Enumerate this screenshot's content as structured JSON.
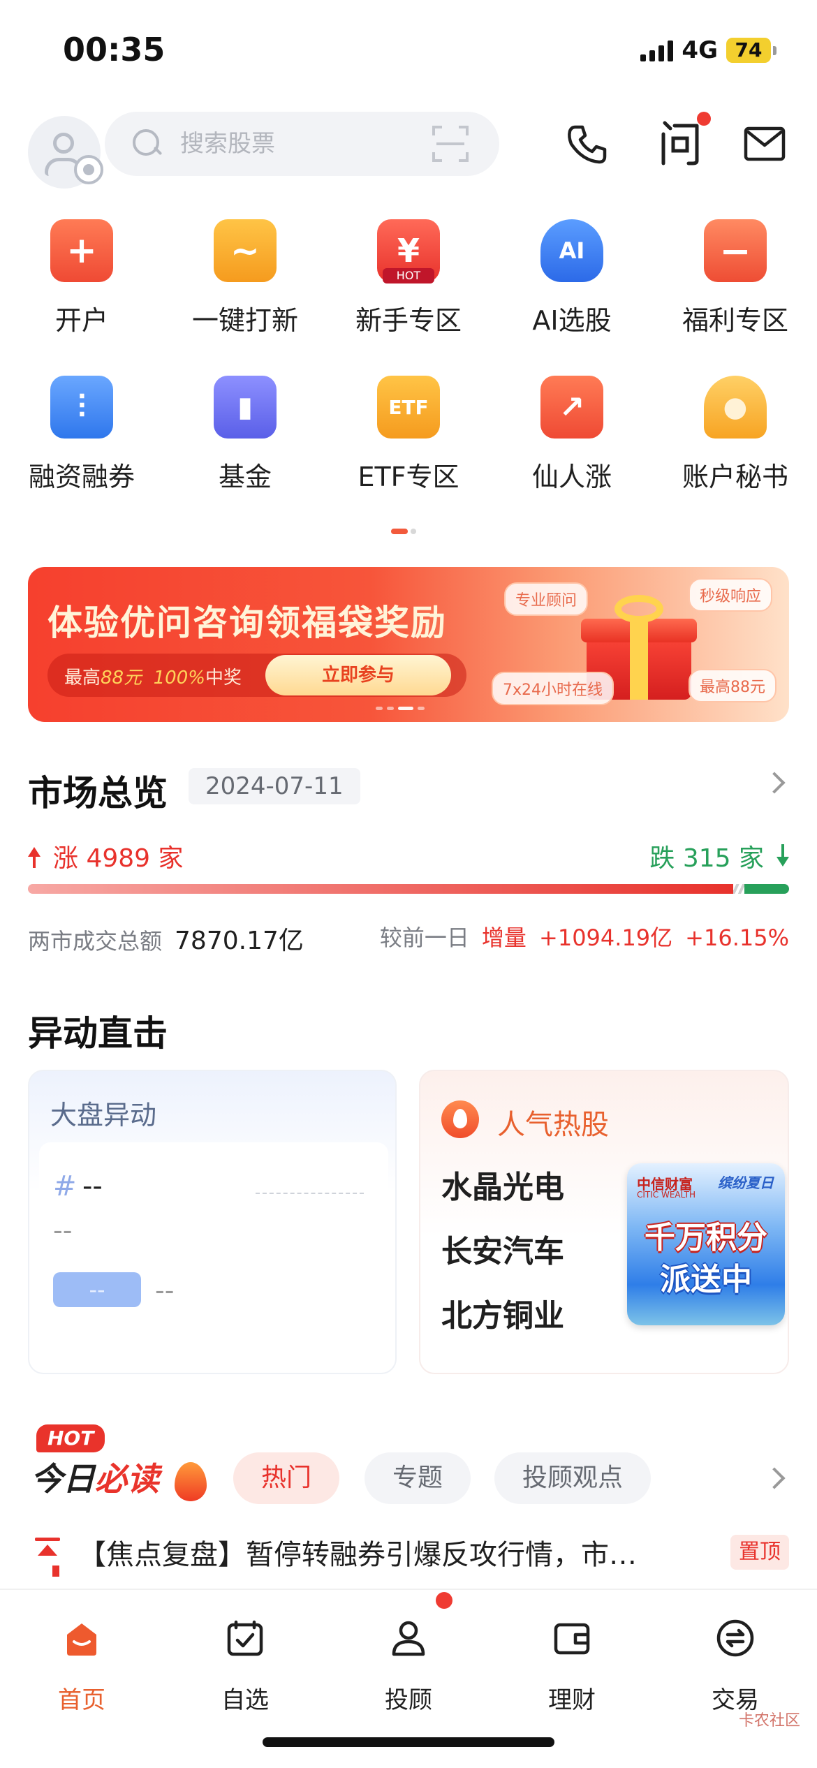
{
  "status_bar": {
    "time": "00:35",
    "network": "4G",
    "battery": "74"
  },
  "header": {
    "search_placeholder": "搜索股票",
    "icons": [
      "avatar",
      "search-icon",
      "scan-icon",
      "phone-icon",
      "wen-icon",
      "mail-icon"
    ],
    "wen_glyph": "问"
  },
  "menu": {
    "items": [
      {
        "label": "开户",
        "icon": "plus-icon",
        "color": "#f25a3c",
        "glyph": "+"
      },
      {
        "label": "一键打新",
        "icon": "trend-icon",
        "color": "#f9a82d",
        "glyph": "~"
      },
      {
        "label": "新手专区",
        "icon": "yen-hot-icon",
        "color": "#f1473b",
        "glyph": "¥",
        "badge": "HOT"
      },
      {
        "label": "AI选股",
        "icon": "ai-shield-icon",
        "color": "#3a7bef",
        "glyph": "AI"
      },
      {
        "label": "福利专区",
        "icon": "gift-box-icon",
        "color": "#f36a47",
        "glyph": "−"
      },
      {
        "label": "融资融券",
        "icon": "candlestick-icon",
        "color": "#3d86ee",
        "glyph": "⫶"
      },
      {
        "label": "基金",
        "icon": "bar-chart-icon",
        "color": "#6a6ff0",
        "glyph": "▮"
      },
      {
        "label": "ETF专区",
        "icon": "etf-icon",
        "color": "#f9a82d",
        "glyph": "ETF"
      },
      {
        "label": "仙人涨",
        "icon": "trend-up-icon",
        "color": "#f25a3c",
        "glyph": "↗"
      },
      {
        "label": "账户秘书",
        "icon": "secretary-icon",
        "color": "#f9a82d",
        "glyph": "●"
      }
    ],
    "page_dots": {
      "active_color": "#f25a3c",
      "inactive_color": "#d8d8d8"
    }
  },
  "banner": {
    "title": "体验优问咨询领福袋奖励",
    "sub_prefix": "最高",
    "sub_amount": "88元",
    "sub_percent": "100%",
    "sub_suffix": "中奖",
    "button": "立即参与",
    "tags": [
      "专业顾问",
      "秒级响应",
      "7x24小时在线",
      "最高88元"
    ]
  },
  "market": {
    "title": "市场总览",
    "date": "2024-07-11",
    "rise_label": "涨 4989 家",
    "fall_label": "跌 315 家",
    "rise_count": 4989,
    "fall_count": 315,
    "turnover_label": "两市成交总额",
    "turnover_value": "7870.17亿",
    "compare_label": "较前一日",
    "compare_change_label": "增量",
    "compare_change_value": "+1094.19亿",
    "compare_percent": "+16.15%",
    "colors": {
      "rise": "#e8322c",
      "fall": "#27a05a"
    }
  },
  "movers": {
    "title": "异动直击",
    "left_card": {
      "title": "大盘异动",
      "hash": "#",
      "line1": "--",
      "line2": "--",
      "chip": "--",
      "chip_value": "--"
    },
    "right_card": {
      "title": "人气热股",
      "stocks": [
        "水晶光电",
        "长安汽车",
        "北方铜业"
      ],
      "promo": {
        "brand": "中信财富",
        "brand_en": "CITIC WEALTH",
        "tag": "缤纷夏日",
        "line1": "千万积分",
        "line2": "派送中"
      }
    }
  },
  "must_read": {
    "hot_badge": "HOT",
    "title_prefix": "今日",
    "title_highlight": "必读",
    "tabs": [
      {
        "label": "热门",
        "active": true
      },
      {
        "label": "专题",
        "active": false
      },
      {
        "label": "投顾观点",
        "active": false
      }
    ],
    "headline": "【焦点复盘】暂停转融券引爆反攻行情，市…",
    "headline_tag": "置顶"
  },
  "bottom_nav": {
    "items": [
      {
        "label": "首页",
        "icon": "home-icon",
        "active": true
      },
      {
        "label": "自选",
        "icon": "watchlist-icon",
        "active": false
      },
      {
        "label": "投顾",
        "icon": "advisor-icon",
        "active": false,
        "dot": true
      },
      {
        "label": "理财",
        "icon": "wallet-icon",
        "active": false
      },
      {
        "label": "交易",
        "icon": "exchange-icon",
        "active": false
      }
    ]
  },
  "watermark": "卡农社区"
}
